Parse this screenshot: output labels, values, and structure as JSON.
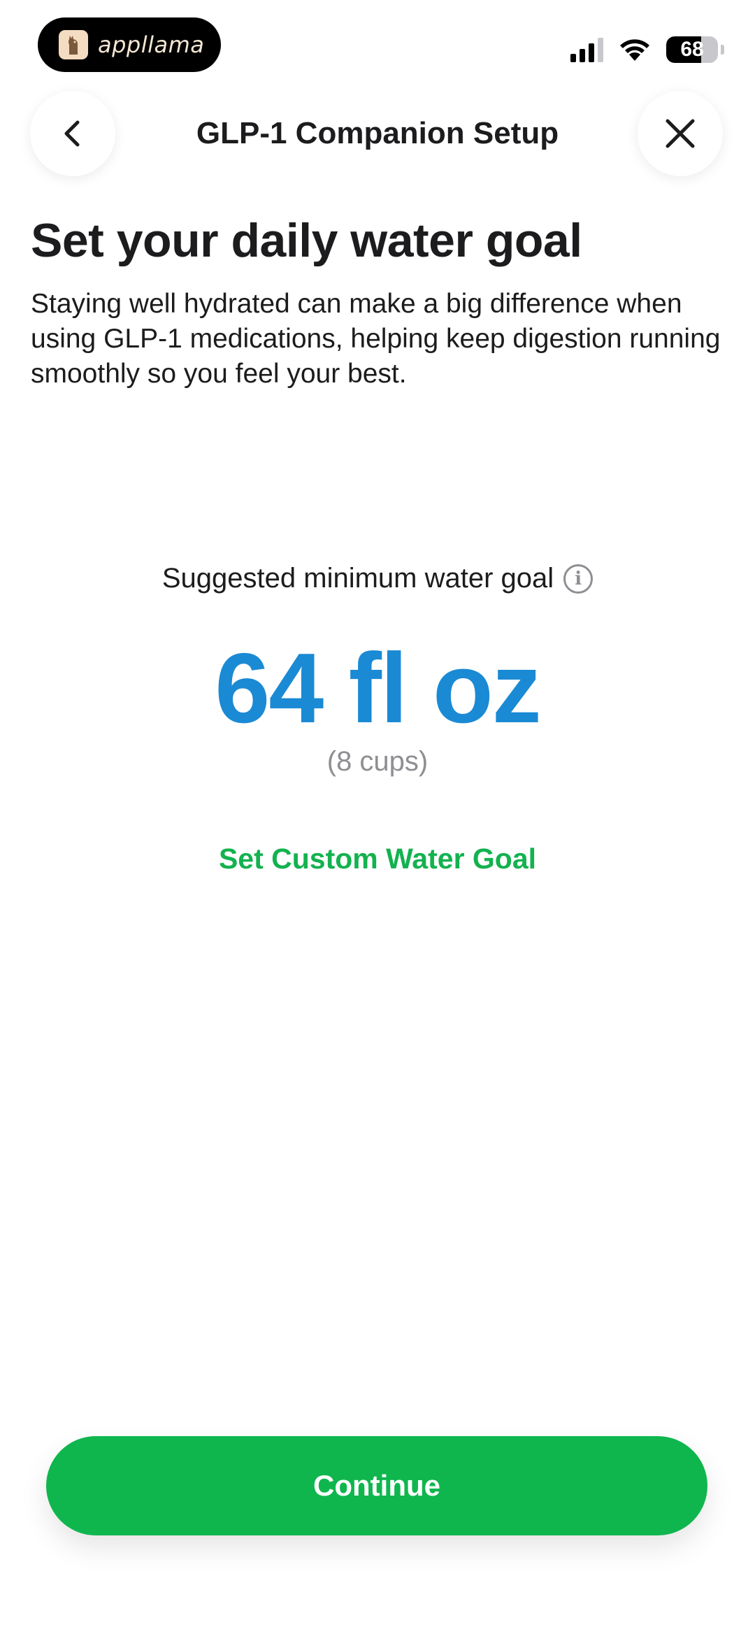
{
  "status_bar": {
    "app_name": "appllama",
    "battery_level": "68",
    "battery_percent": 68,
    "signal_bars": 3,
    "icons": [
      "cellular-signal-icon",
      "wifi-icon",
      "battery-icon"
    ]
  },
  "header": {
    "title": "GLP-1 Companion Setup",
    "back_icon": "chevron-left-icon",
    "close_icon": "close-icon"
  },
  "main": {
    "heading": "Set your daily water goal",
    "description": "Staying well hydrated can make a big difference when using GLP-1 medications, helping keep digestion running smoothly so you feel your best.",
    "goal_label": "Suggested minimum water goal",
    "info_icon": "info-icon",
    "goal_value": "64 fl oz",
    "goal_cups": "(8 cups)",
    "custom_goal_link": "Set Custom Water Goal"
  },
  "footer": {
    "continue_label": "Continue"
  },
  "colors": {
    "accent_blue": "#1a8ad4",
    "accent_green": "#0fb64e",
    "link_green": "#13b24f",
    "text_primary": "#1c1c1e",
    "text_secondary": "#8e8e93"
  }
}
